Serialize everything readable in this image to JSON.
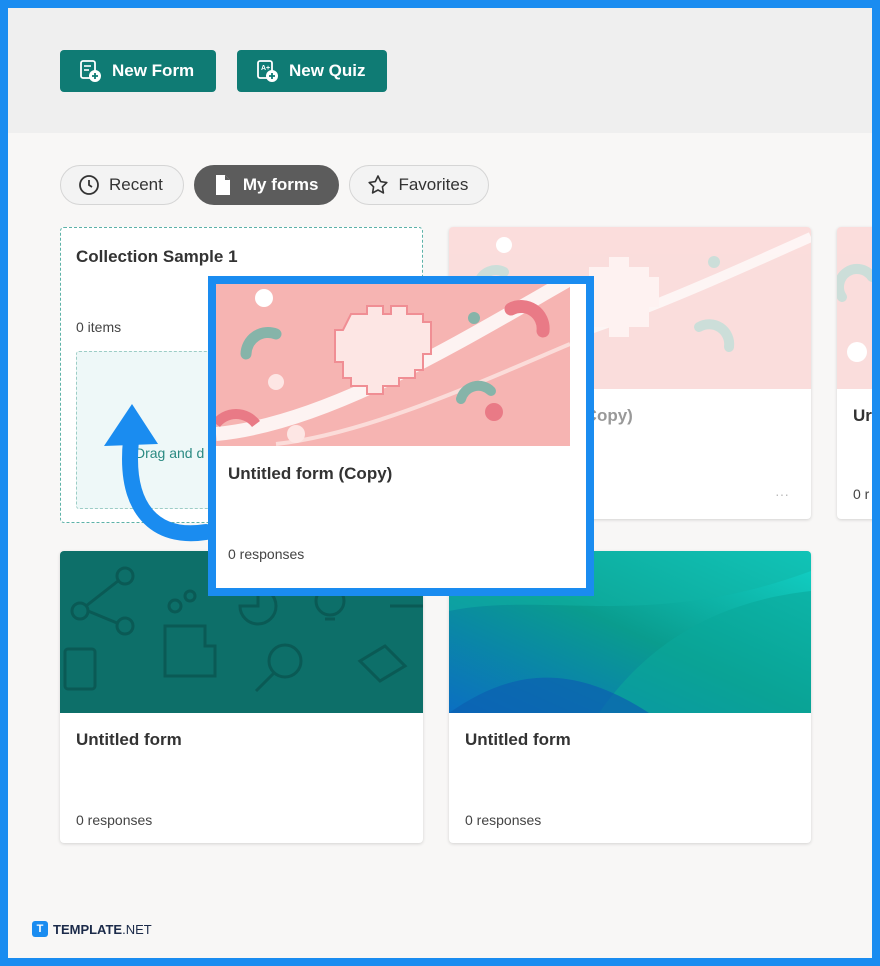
{
  "toolbar": {
    "new_form_label": "New Form",
    "new_quiz_label": "New Quiz"
  },
  "filters": {
    "recent": "Recent",
    "my_forms": "My forms",
    "favorites": "Favorites",
    "active": "My forms"
  },
  "collection": {
    "title": "Collection Sample 1",
    "count": "0 items",
    "drop_hint": "Drag and d"
  },
  "cards": {
    "copy_behind": {
      "title_fragment": "(Copy)",
      "more": "···"
    },
    "partial_right": {
      "title_fragment": "Ur",
      "meta_fragment": "0 r"
    },
    "dragged": {
      "title": "Untitled form (Copy)",
      "meta": "0 responses"
    },
    "card1": {
      "title": "Untitled form",
      "meta": "0 responses"
    },
    "card2": {
      "title": "Untitled form",
      "meta": "0 responses"
    }
  },
  "watermark": {
    "icon_letter": "T",
    "brand": "TEMPLATE",
    "suffix": ".NET"
  },
  "colors": {
    "accent": "#0f7b74",
    "highlight": "#1a8cf0",
    "pill_active": "#5c5c5c",
    "teal_banner": "#0d6f69"
  }
}
